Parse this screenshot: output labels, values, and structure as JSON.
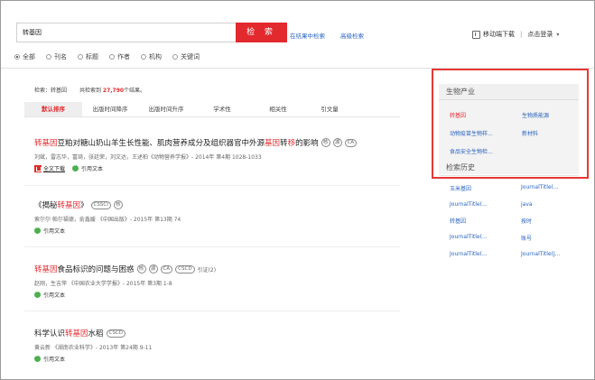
{
  "search": {
    "value": "转基因",
    "button_label": "检 索"
  },
  "top_links": {
    "in_results": "在结果中检索",
    "advanced": "高级检索"
  },
  "header": {
    "mobile_download": "移动端下载",
    "separator": "|",
    "login": "点击登录",
    "caret": "▾"
  },
  "filters": [
    {
      "label": "全部",
      "checked": true
    },
    {
      "label": "刊名",
      "checked": false
    },
    {
      "label": "标题",
      "checked": false
    },
    {
      "label": "作者",
      "checked": false
    },
    {
      "label": "机构",
      "checked": false
    },
    {
      "label": "关键词",
      "checked": false
    }
  ],
  "results_summary": {
    "query_prefix": "检索：",
    "query": "转基因",
    "count_prefix": "共检索到",
    "count": "27,790",
    "count_suffix": "个结果。"
  },
  "sort_tabs": [
    "默认排序",
    "出版时间降序",
    "出版时间升序",
    "学术性",
    "相关性",
    "引文量"
  ],
  "results": [
    {
      "title_parts": [
        {
          "text": "转基因",
          "hl": true
        },
        {
          "text": "豆粕对糖山奶山羊生长性能、肌肉营养成分及组织器官中外源",
          "hl": false
        },
        {
          "text": "基因",
          "hl": true
        },
        {
          "text": "转",
          "hl": false
        },
        {
          "text": "移",
          "hl": true
        },
        {
          "text": "的影响",
          "hl": false
        }
      ],
      "tags": [
        "核",
        "湖",
        "CA"
      ],
      "citation": "",
      "meta": "刘斌，雷志华，富琦，张廷荣，刘文达，王述柏《动物营养学报》- 2014年 第4期 1028-1033",
      "download_label": "全文下载",
      "cite_label": "引用文本"
    },
    {
      "title_parts": [
        {
          "text": "《揭秘",
          "hl": false
        },
        {
          "text": "转基因",
          "hl": true
        },
        {
          "text": "》",
          "hl": false
        }
      ],
      "tags": [
        "CSSCI",
        "核"
      ],
      "citation": "",
      "meta": "索尔尔·帕尔福德，俞鑫媛 《中国出版》- 2015年 第13期 74",
      "download_label": "",
      "cite_label": "引用文本"
    },
    {
      "title_parts": [
        {
          "text": "转基因",
          "hl": true
        },
        {
          "text": "食品标识的问题与困惑",
          "hl": false
        }
      ],
      "tags": [
        "核",
        "湖",
        "CA",
        "CSCD"
      ],
      "citation": "引证(2)",
      "meta": "赵刚，生吉萍 《中国农业大学学报》- 2015年 第3期 1-8",
      "download_label": "",
      "cite_label": "引用文本"
    },
    {
      "title_parts": [
        {
          "text": "科学认识",
          "hl": false
        },
        {
          "text": "转基因",
          "hl": true
        },
        {
          "text": "水稻",
          "hl": false
        }
      ],
      "tags": [
        "CSCD"
      ],
      "citation": "",
      "meta": "黄云新 《湖南农业科学》- 2013年 第24期 9-11",
      "download_label": "",
      "cite_label": "引用文本"
    }
  ],
  "sidebar": {
    "industry_title": "生物产业",
    "industry_items": [
      {
        "label": "转基因",
        "style": "red"
      },
      {
        "label": "生物质能源",
        "style": "blue"
      },
      {
        "label": "动物疫苗生物样...",
        "style": "blue"
      },
      {
        "label": "新材料",
        "style": "blue"
      },
      {
        "label": "食品安全生物检...",
        "style": "blue"
      }
    ],
    "history_title": "检索历史",
    "history_items": [
      "玉米基因",
      "JournalTitle(...",
      "JournalTitle(...",
      "java",
      "转基因",
      "按时",
      "JournalTitle(...",
      "账号",
      "JournalTitle(...",
      "JournalTitle(J..."
    ]
  },
  "colors": {
    "accent_red": "#e2292d",
    "link_blue": "#2a64c0",
    "highlight_box": "#e53935"
  }
}
